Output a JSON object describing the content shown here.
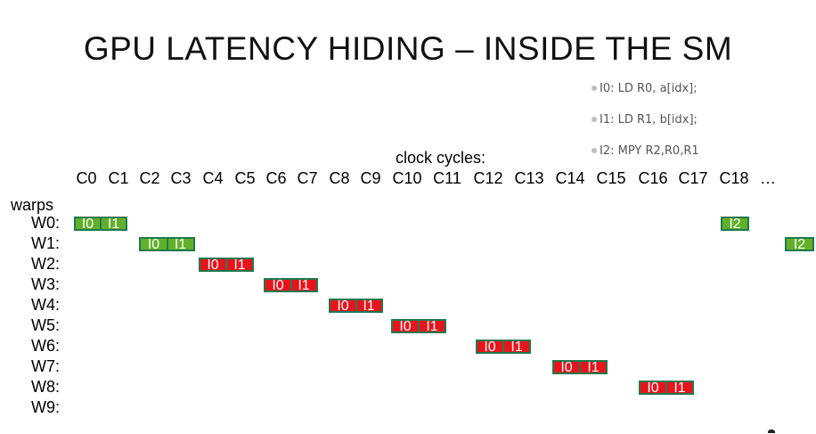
{
  "title": "GPU LATENCY HIDING – INSIDE THE SM",
  "instructions": [
    "I0: LD R0, a[idx];",
    "I1: LD R1, b[idx];",
    "I2: MPY R2,R0,R1"
  ],
  "clock_label": "clock cycles:",
  "cycles": [
    "C0",
    "C1",
    "C2",
    "C3",
    "C4",
    "C5",
    "C6",
    "C7",
    "C8",
    "C9",
    "C10",
    "C11",
    "C12",
    "C13",
    "C14",
    "C15",
    "C16",
    "C17",
    "C18",
    "…"
  ],
  "warps_label": "warps",
  "warps": [
    "W0:",
    "W1:",
    "W2:",
    "W3:",
    "W4:",
    "W5:",
    "W6:",
    "W7:",
    "W8:",
    "W9:"
  ],
  "colors": {
    "issued_ok": "#62b02a",
    "stalled": "#e8141c",
    "box_border": "#1e7a4e"
  },
  "blocks": [
    {
      "warp": "W0",
      "cycle": "C0",
      "labels": [
        "I0",
        "I1"
      ],
      "status": "green"
    },
    {
      "warp": "W0",
      "cycle": "C18",
      "labels": [
        "I2"
      ],
      "status": "green"
    },
    {
      "warp": "W1",
      "cycle": "C2",
      "labels": [
        "I0",
        "I1"
      ],
      "status": "green"
    },
    {
      "warp": "W1",
      "cycle": "…",
      "labels": [
        "I2"
      ],
      "status": "green"
    },
    {
      "warp": "W2",
      "cycle": "C4",
      "labels": [
        "I0",
        "I1"
      ],
      "status": "red"
    },
    {
      "warp": "W3",
      "cycle": "C6",
      "labels": [
        "I0",
        "I1"
      ],
      "status": "red"
    },
    {
      "warp": "W4",
      "cycle": "C8",
      "labels": [
        "I0",
        "I1"
      ],
      "status": "red"
    },
    {
      "warp": "W5",
      "cycle": "C10",
      "labels": [
        "I0",
        "I1"
      ],
      "status": "red"
    },
    {
      "warp": "W6",
      "cycle": "C12",
      "labels": [
        "I0",
        "I1"
      ],
      "status": "red"
    },
    {
      "warp": "W7",
      "cycle": "C14",
      "labels": [
        "I0",
        "I1"
      ],
      "status": "red"
    },
    {
      "warp": "W8",
      "cycle": "C16",
      "labels": [
        "I0",
        "I1"
      ],
      "status": "red"
    }
  ]
}
